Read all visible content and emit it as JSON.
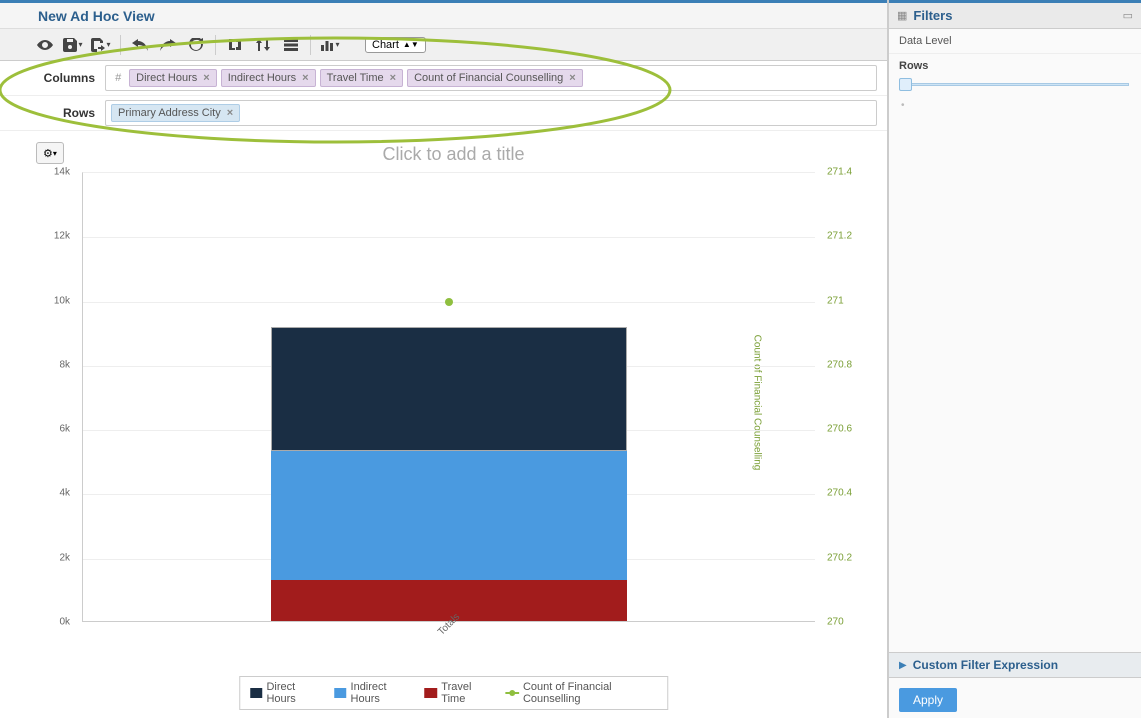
{
  "header": {
    "title": "New Ad Hoc View"
  },
  "toolbar": {
    "visualization_type": "Chart"
  },
  "columns_row": {
    "label": "Columns",
    "hash": "#",
    "pills": [
      {
        "label": "Direct Hours"
      },
      {
        "label": "Indirect Hours"
      },
      {
        "label": "Travel Time"
      },
      {
        "label": "Count of Financial Counselling"
      }
    ]
  },
  "rows_row": {
    "label": "Rows",
    "pills": [
      {
        "label": "Primary Address City"
      }
    ]
  },
  "chart": {
    "title_placeholder": "Click to add a title"
  },
  "chart_data": {
    "type": "bar",
    "categories": [
      "Totals"
    ],
    "left_axis": {
      "ticks": [
        "0k",
        "2k",
        "4k",
        "6k",
        "8k",
        "10k",
        "12k",
        "14k"
      ],
      "min": 0,
      "max": 14000
    },
    "right_axis": {
      "label": "Count of Financial Counselling",
      "ticks": [
        "270",
        "270.2",
        "270.4",
        "270.6",
        "270.8",
        "271",
        "271.2",
        "271.4"
      ],
      "min": 270,
      "max": 271.4
    },
    "series": [
      {
        "name": "Direct Hours",
        "color": "#1a2e44",
        "values": [
          3850
        ]
      },
      {
        "name": "Indirect Hours",
        "color": "#4a9ae0",
        "values": [
          4000
        ]
      },
      {
        "name": "Travel Time",
        "color": "#a21c1c",
        "values": [
          1300
        ]
      },
      {
        "name": "Count of Financial Counselling",
        "color": "#8fbf3f",
        "type": "line",
        "axis": "right",
        "values": [
          271
        ]
      }
    ],
    "stacked_total": 9150
  },
  "legend": {
    "items": [
      {
        "label": "Direct Hours"
      },
      {
        "label": "Indirect Hours"
      },
      {
        "label": "Travel Time"
      },
      {
        "label": "Count of Financial Counselling"
      }
    ]
  },
  "filters": {
    "title": "Filters",
    "data_level": "Data Level",
    "rows_label": "Rows",
    "custom_filter": "Custom Filter Expression",
    "apply": "Apply"
  }
}
